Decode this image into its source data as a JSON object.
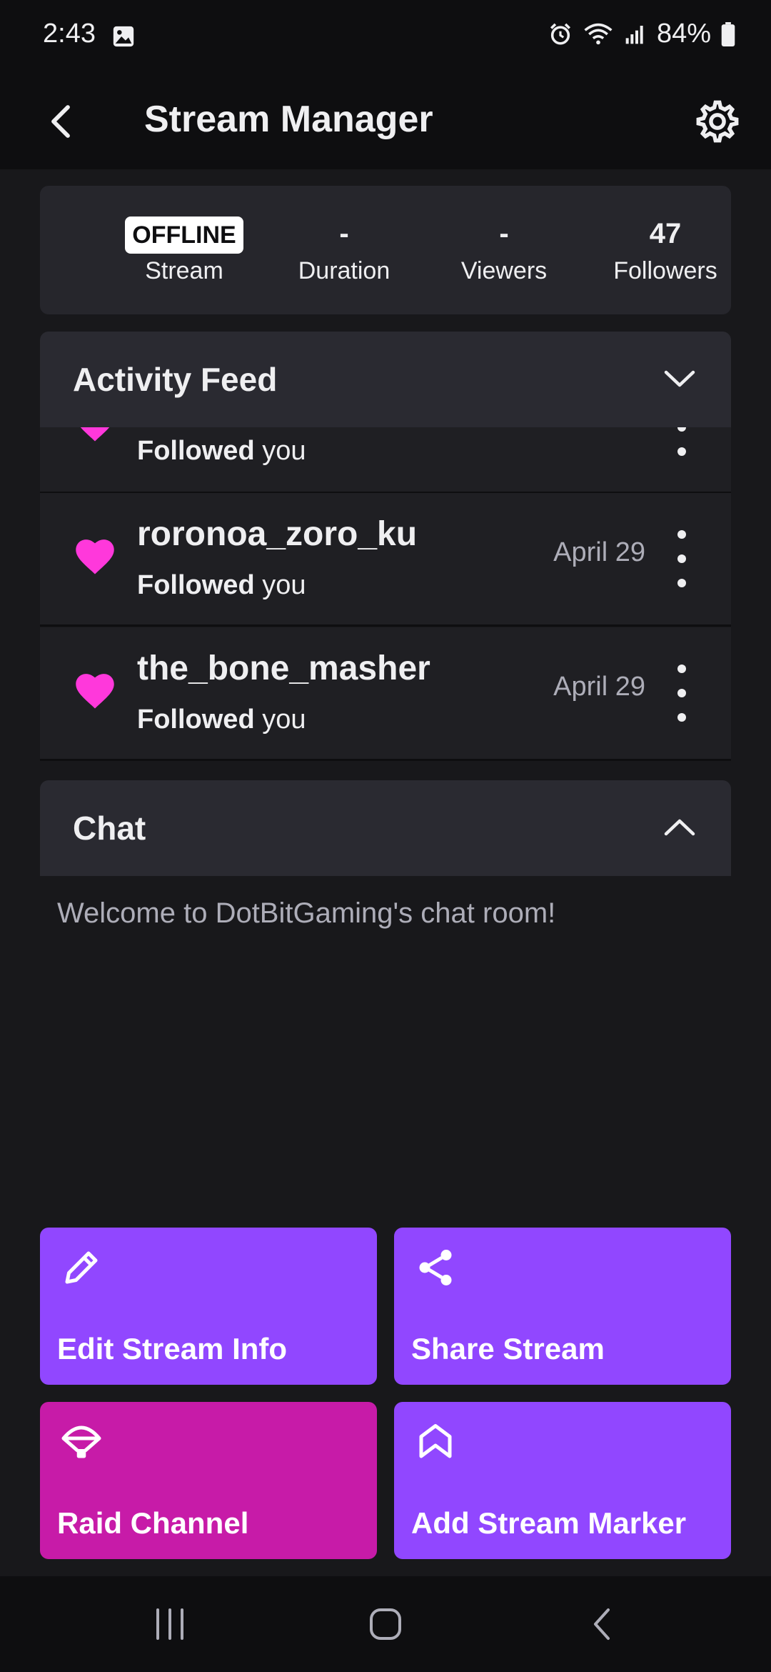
{
  "status_bar": {
    "time": "2:43",
    "battery": "84%",
    "icons": [
      "image-icon",
      "alarm-icon",
      "wifi-icon",
      "signal-icon",
      "battery-icon"
    ]
  },
  "header": {
    "title": "Stream Manager",
    "back_icon": "back-arrow-icon",
    "settings_icon": "gear-icon"
  },
  "stats": {
    "stream_status": "OFFLINE",
    "stream_label": "Stream",
    "duration_value": "-",
    "duration_label": "Duration",
    "viewers_value": "-",
    "viewers_label": "Viewers",
    "followers_value": "47",
    "followers_label": "Followers"
  },
  "activity_feed": {
    "title": "Activity Feed",
    "items": [
      {
        "name": "",
        "action_bold": "Followed",
        "action_rest": " you",
        "date": ""
      },
      {
        "name": "roronoa_zoro_ku",
        "action_bold": "Followed",
        "action_rest": " you",
        "date": "April 29"
      },
      {
        "name": "the_bone_masher",
        "action_bold": "Followed",
        "action_rest": " you",
        "date": "April 29"
      }
    ]
  },
  "chat": {
    "title": "Chat",
    "welcome": "Welcome to DotBitGaming's chat room!"
  },
  "actions": {
    "edit_label": "Edit Stream Info",
    "share_label": "Share Stream",
    "raid_label": "Raid Channel",
    "marker_label": "Add Stream Marker"
  },
  "colors": {
    "background": "#18181b",
    "accent_purple": "#9147ff",
    "raid_magenta": "#c71ba8",
    "heart_pink": "#ff38db"
  }
}
